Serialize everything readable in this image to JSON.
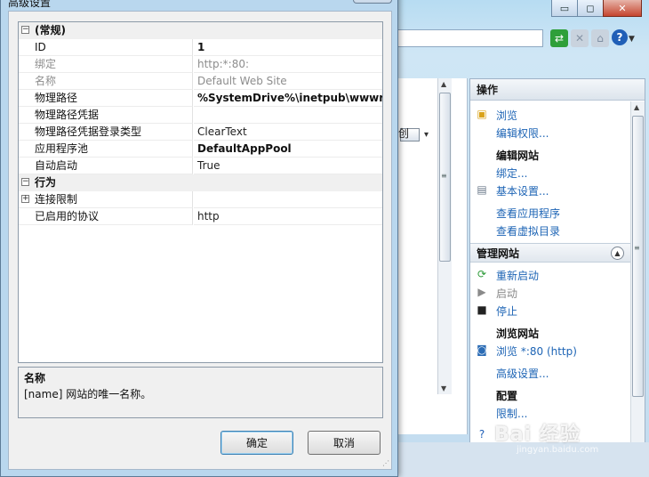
{
  "dialog": {
    "title": "高级设置",
    "grid": {
      "rows": [
        {
          "type": "category",
          "expander": "⊟",
          "name": "(常规)"
        },
        {
          "type": "prop",
          "name": "ID",
          "value": "1",
          "bold": true,
          "dim": false
        },
        {
          "type": "prop",
          "name": "绑定",
          "value": "http:*:80:",
          "bold": false,
          "dim": true
        },
        {
          "type": "prop",
          "name": "名称",
          "value": "Default Web Site",
          "bold": false,
          "dim": true
        },
        {
          "type": "prop",
          "name": "物理路径",
          "value": "%SystemDrive%\\inetpub\\wwwroo",
          "bold": true,
          "dim": false
        },
        {
          "type": "prop",
          "name": "物理路径凭据",
          "value": "",
          "bold": false,
          "dim": false
        },
        {
          "type": "prop",
          "name": "物理路径凭据登录类型",
          "value": "ClearText",
          "bold": false,
          "dim": false
        },
        {
          "type": "prop",
          "name": "应用程序池",
          "value": "DefaultAppPool",
          "bold": true,
          "dim": false
        },
        {
          "type": "prop",
          "name": "自动启动",
          "value": "True",
          "bold": false,
          "dim": false
        },
        {
          "type": "category",
          "expander": "⊟",
          "name": "行为"
        },
        {
          "type": "prop",
          "name": "连接限制",
          "value": "",
          "bold": false,
          "dim": false,
          "expander": "⊞"
        },
        {
          "type": "prop",
          "name": "已启用的协议",
          "value": "http",
          "bold": false,
          "dim": false
        }
      ]
    },
    "description": {
      "title": "名称",
      "text": "[name] 网站的唯一名称。"
    },
    "buttons": {
      "ok": "确定",
      "cancel": "取消"
    }
  },
  "background": {
    "center_pane": {
      "partial_text": "创"
    },
    "actions": {
      "header": "操作",
      "items": [
        {
          "label": "浏览",
          "icon": "folder-icon",
          "style": "link"
        },
        {
          "label": "编辑权限...",
          "icon": "",
          "style": "link"
        },
        {
          "label": "编辑网站",
          "icon": "",
          "style": "heading"
        },
        {
          "label": "绑定...",
          "icon": "",
          "style": "link"
        },
        {
          "label": "基本设置...",
          "icon": "settings-icon",
          "style": "link"
        },
        {
          "label": "查看应用程序",
          "icon": "",
          "style": "link"
        },
        {
          "label": "查看虚拟目录",
          "icon": "",
          "style": "link"
        }
      ],
      "manage_group": "管理网站",
      "manage_items": [
        {
          "label": "重新启动",
          "icon": "restart-icon",
          "style": "link"
        },
        {
          "label": "启动",
          "icon": "play-icon",
          "style": "disabled"
        },
        {
          "label": "停止",
          "icon": "stop-icon",
          "style": "link"
        },
        {
          "label": "浏览网站",
          "icon": "",
          "style": "heading"
        },
        {
          "label": "浏览 *:80 (http)",
          "icon": "browse-icon",
          "style": "link"
        },
        {
          "label": "高级设置...",
          "icon": "",
          "style": "link"
        },
        {
          "label": "配置",
          "icon": "",
          "style": "heading"
        },
        {
          "label": "限制...",
          "icon": "",
          "style": "link"
        }
      ]
    },
    "watermark": "Bai 经验",
    "watermark_sub": "jingyan.baidu.com"
  }
}
